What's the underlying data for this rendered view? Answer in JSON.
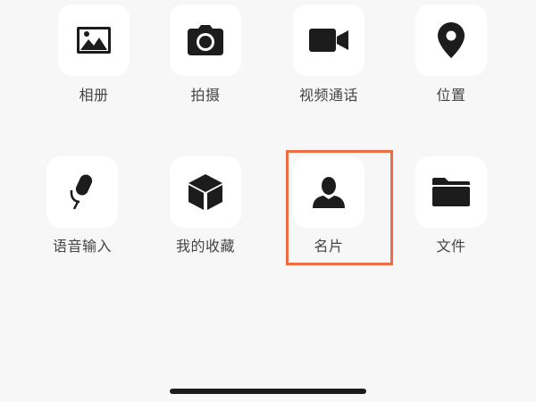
{
  "panel": {
    "row1": [
      {
        "label": "相册",
        "icon": "photo-album-icon"
      },
      {
        "label": "拍摄",
        "icon": "camera-icon"
      },
      {
        "label": "视频通话",
        "icon": "video-call-icon"
      },
      {
        "label": "位置",
        "icon": "location-pin-icon"
      }
    ],
    "row2": [
      {
        "label": "语音输入",
        "icon": "microphone-icon"
      },
      {
        "label": "我的收藏",
        "icon": "favorites-cube-icon"
      },
      {
        "label": "名片",
        "icon": "contact-card-person-icon"
      },
      {
        "label": "文件",
        "icon": "folder-icon"
      }
    ]
  },
  "colors": {
    "highlight": "#ee6c44",
    "tile_bg": "#ffffff",
    "background": "#f7f7f7",
    "label": "#444444",
    "icon": "#1c1c1c"
  }
}
